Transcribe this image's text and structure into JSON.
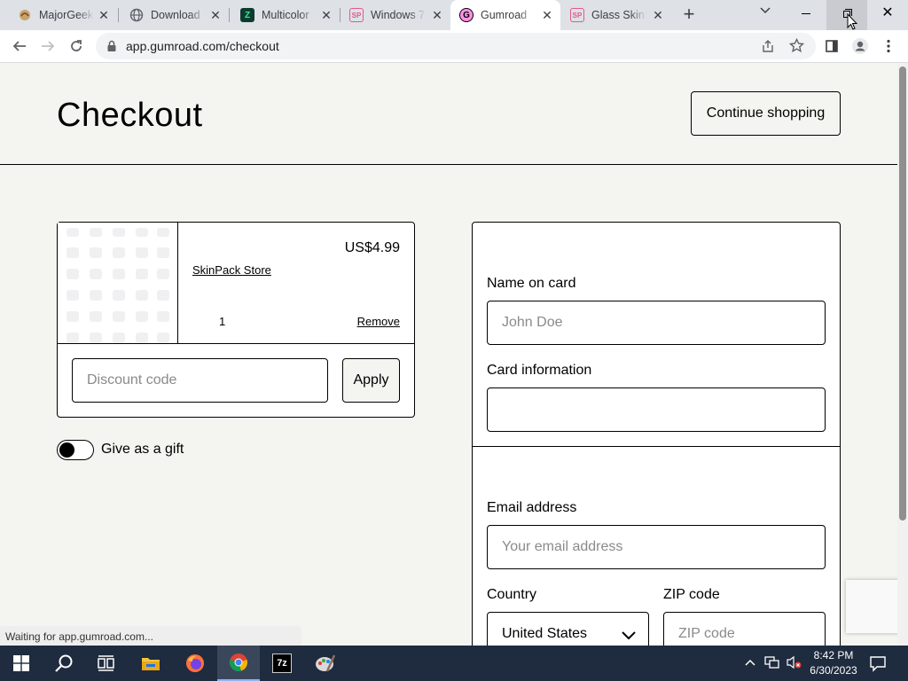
{
  "browser": {
    "tabs": [
      {
        "title": "MajorGeeks",
        "icon": "majorgeeks-icon"
      },
      {
        "title": "Download",
        "icon": "globe-icon"
      },
      {
        "title": "Multicolor",
        "icon": "multicolor-icon"
      },
      {
        "title": "Windows 7",
        "icon": "skinpack-icon"
      },
      {
        "title": "Gumroad",
        "icon": "gumroad-icon"
      },
      {
        "title": "Glass SkinP",
        "icon": "skinpack-icon"
      }
    ],
    "active_tab": 4,
    "url": "app.gumroad.com/checkout",
    "status": "Waiting for app.gumroad.com..."
  },
  "page": {
    "title": "Checkout",
    "continue_label": "Continue shopping"
  },
  "cart": {
    "price": "US$4.99",
    "store": "SkinPack Store",
    "quantity": "1",
    "remove_label": "Remove",
    "discount_placeholder": "Discount code",
    "apply_label": "Apply",
    "gift_label": "Give as a gift"
  },
  "payment": {
    "name_label": "Name on card",
    "name_placeholder": "John Doe",
    "card_label": "Card information",
    "email_label": "Email address",
    "email_placeholder": "Your email address",
    "country_label": "Country",
    "country_value": "United States",
    "zip_label": "ZIP code",
    "zip_placeholder": "ZIP code"
  },
  "taskbar": {
    "time": "8:42 PM",
    "date": "6/30/2023"
  },
  "colors": {
    "page_bg": "#f4f4f0",
    "taskbar_bg": "#1f2b3e",
    "tabstrip_bg": "#dee1e6"
  }
}
